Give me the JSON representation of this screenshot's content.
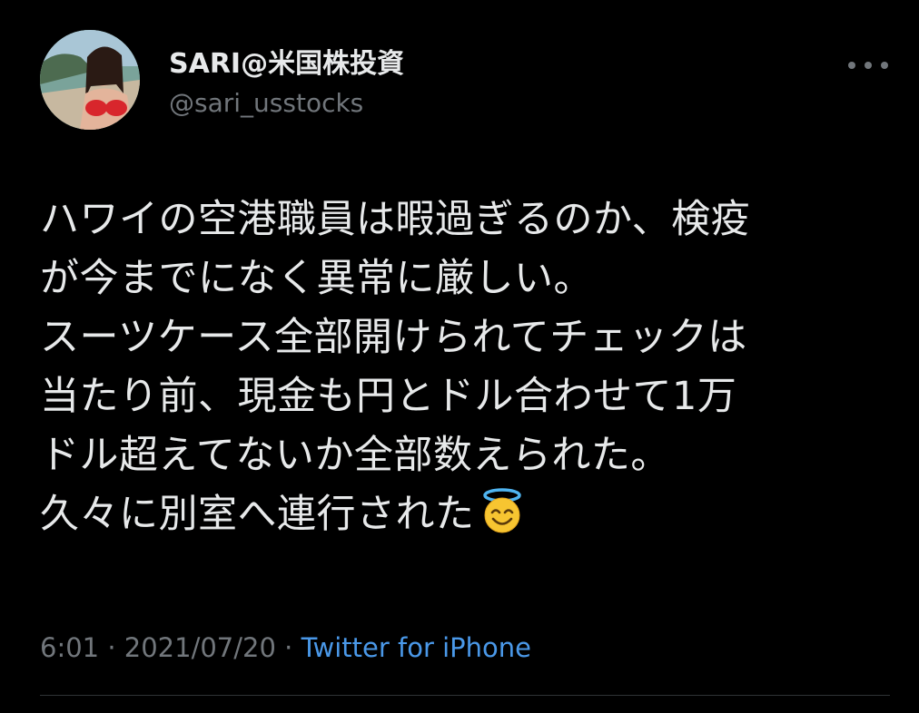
{
  "author": {
    "display_name": "SARI@米国株投資",
    "handle": "@sari_usstocks",
    "avatar_icon": "profile-photo"
  },
  "menu": {
    "icon": "more-horizontal-icon"
  },
  "tweet": {
    "lines": [
      "ハワイの空港職員は暇過ぎるのか、検疫",
      "が今までになく異常に厳しい。",
      "スーツケース全部開けられてチェックは",
      "当たり前、現金も円とドル合わせて1万",
      "ドル超えてないか全部数えられた。",
      "久々に別室へ連行された"
    ],
    "trailing_emoji": "smiling-face-with-halo-icon"
  },
  "meta": {
    "time": "6:01",
    "separator1": " · ",
    "date": "2021/07/20",
    "separator2": " · ",
    "source": "Twitter for iPhone"
  },
  "colors": {
    "background": "#000000",
    "primary_text": "#e7e9ea",
    "secondary_text": "#71767b",
    "link": "#4a98e8",
    "divider": "#2f3336"
  }
}
